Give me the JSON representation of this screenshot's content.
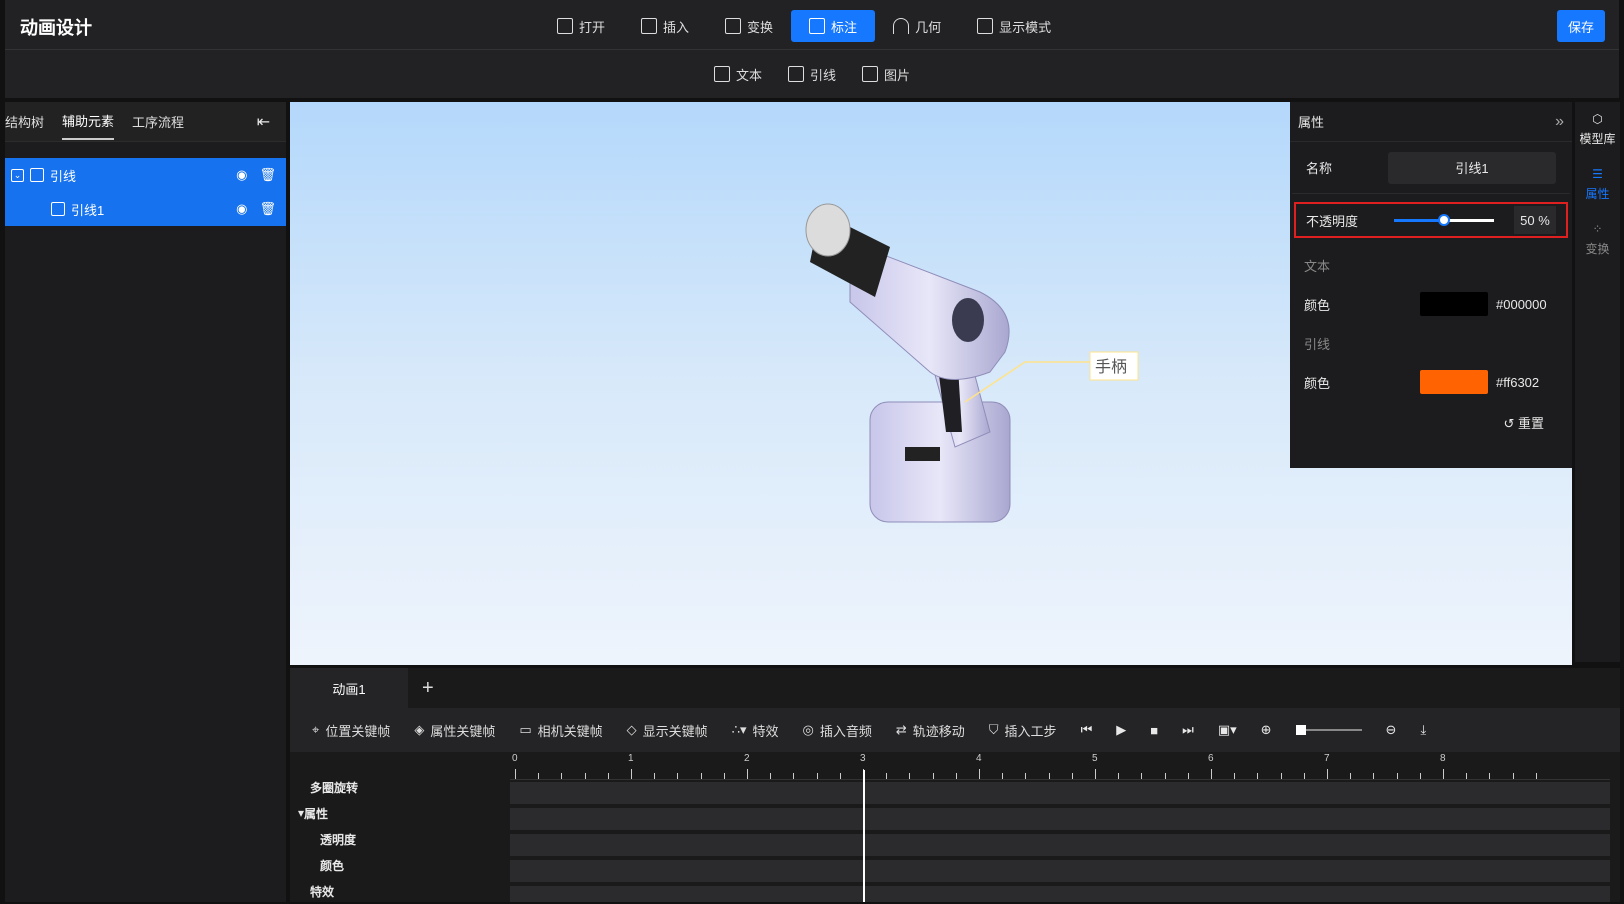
{
  "app": {
    "title": "动画设计",
    "save_label": "保存"
  },
  "top_menu": [
    {
      "label": "打开",
      "icon": "file-import-icon",
      "active": false
    },
    {
      "label": "插入",
      "icon": "cube-icon",
      "active": false
    },
    {
      "label": "变换",
      "icon": "transform-icon",
      "active": false
    },
    {
      "label": "标注",
      "icon": "annotation-icon",
      "active": true
    },
    {
      "label": "几何",
      "icon": "arc-icon",
      "active": false
    },
    {
      "label": "显示模式",
      "icon": "display-mode-icon",
      "active": false
    }
  ],
  "sub_menu": [
    {
      "label": "文本",
      "icon": "text-icon"
    },
    {
      "label": "引线",
      "icon": "leader-icon"
    },
    {
      "label": "图片",
      "icon": "image-icon"
    }
  ],
  "left_panel": {
    "tabs": [
      "结构树",
      "辅助元素",
      "工序流程"
    ],
    "active_tab": "辅助元素",
    "tree": [
      {
        "label": "引线",
        "level": 0,
        "expanded": true
      },
      {
        "label": "引线1",
        "level": 1
      }
    ]
  },
  "viewport": {
    "annotation_label": "手柄",
    "accent": "#ffe38a"
  },
  "properties": {
    "title": "属性",
    "name_label": "名称",
    "name_value": "引线1",
    "opacity_label": "不透明度",
    "opacity_value": 50,
    "opacity_text": "50 %",
    "text_section": "文本",
    "text_color_label": "颜色",
    "text_color": "#000000",
    "leader_section": "引线",
    "leader_color_label": "颜色",
    "leader_color": "#ff6302",
    "reset_label": "重置"
  },
  "right_rail": [
    {
      "label": "模型库",
      "icon": "model-library-icon"
    },
    {
      "label": "属性",
      "icon": "properties-icon",
      "active": true
    },
    {
      "label": "变换",
      "icon": "transform-icon"
    }
  ],
  "timeline": {
    "tab": "动画1",
    "tools": [
      "位置关键帧",
      "属性关键帧",
      "相机关键帧",
      "显示关键帧",
      "特效",
      "插入音频",
      "轨迹移动",
      "插入工步"
    ],
    "ruler_labels": [
      "0",
      "1",
      "2",
      "3",
      "4",
      "5",
      "6",
      "7",
      "8"
    ],
    "tracks": [
      "多圈旋转",
      "属性",
      "透明度",
      "颜色",
      "特效"
    ],
    "current_time": 3
  }
}
